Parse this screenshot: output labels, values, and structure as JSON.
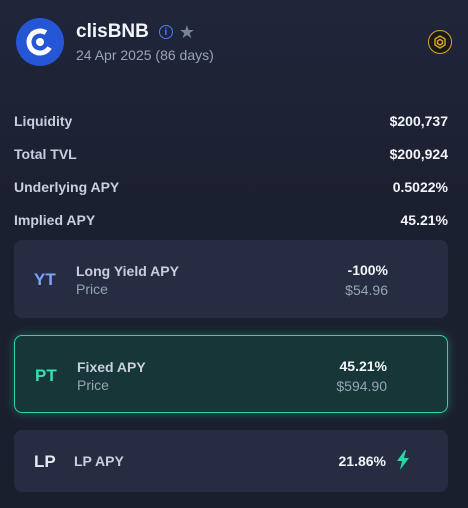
{
  "header": {
    "title": "clisBNB",
    "date": "24 Apr 2025",
    "days": "(86 days)",
    "icons": {
      "logo": "clisbnb-logo-icon",
      "info": "info-icon",
      "star": "star-icon",
      "chain": "bnb-chain-icon"
    }
  },
  "stats": [
    {
      "label": "Liquidity",
      "value": "$200,737"
    },
    {
      "label": "Total TVL",
      "value": "$200,924"
    },
    {
      "label": "Underlying APY",
      "value": "0.5022%"
    },
    {
      "label": "Implied APY",
      "value": "45.21%"
    }
  ],
  "options": {
    "yt": {
      "tag": "YT",
      "name": "Long Yield APY",
      "sub": "Price",
      "value": "-100%",
      "price": "$54.96"
    },
    "pt": {
      "tag": "PT",
      "name": "Fixed APY",
      "sub": "Price",
      "value": "45.21%",
      "price": "$594.90"
    },
    "lp": {
      "tag": "LP",
      "name": "LP APY",
      "value": "21.86%",
      "icon": "lightning-bolt-icon"
    }
  },
  "colors": {
    "accent_green": "#2bd6a4",
    "yt_blue": "#7ea2ff",
    "logo_blue": "#2456d6",
    "chain_gold": "#d8a823"
  }
}
